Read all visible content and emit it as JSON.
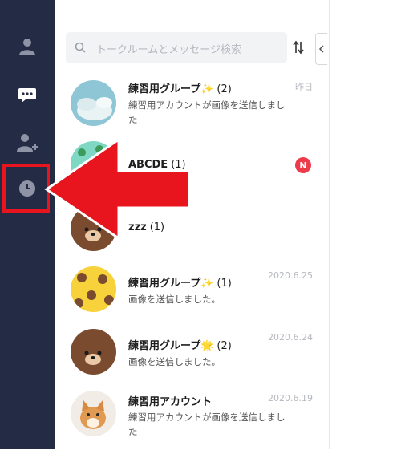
{
  "sidebar": {
    "items": [
      {
        "icon": "person-icon"
      },
      {
        "icon": "chat-bubble-icon"
      },
      {
        "icon": "add-friend-icon"
      },
      {
        "icon": "clock-icon",
        "highlighted": true
      }
    ]
  },
  "search": {
    "placeholder": "トークルームとメッセージ検索",
    "icon": "search-icon"
  },
  "toolbar": {
    "sort_icon": "sort-arrows-icon",
    "collapse_icon": "chevron-left-icon"
  },
  "chats": [
    {
      "name": "練習用グループ✨",
      "count": "(2)",
      "preview": "練習用アカウントが画像を送信しました",
      "date": "昨日",
      "avatar": "sky-clouds"
    },
    {
      "name": "ABCDE",
      "count": "(1)",
      "preview": "",
      "date": "",
      "badge": "N",
      "avatar": "green-pattern"
    },
    {
      "name": "zzz",
      "count": "(1)",
      "preview": "",
      "date": "",
      "avatar": "brown-bear"
    },
    {
      "name": "練習用グループ✨",
      "count": "(1)",
      "preview": "画像を送信しました。",
      "date": "2020.6.25",
      "avatar": "yellow-bears"
    },
    {
      "name": "練習用グループ🌟",
      "count": "(2)",
      "preview": "画像を送信しました。",
      "date": "2020.6.24",
      "avatar": "brown-bear"
    },
    {
      "name": "練習用アカウント",
      "count": "",
      "preview": "練習用アカウントが画像を送信しました",
      "date": "2020.6.19",
      "avatar": "kitten"
    }
  ],
  "annotation": {
    "arrow_color": "#e8141e",
    "box_color": "#e8141e"
  }
}
